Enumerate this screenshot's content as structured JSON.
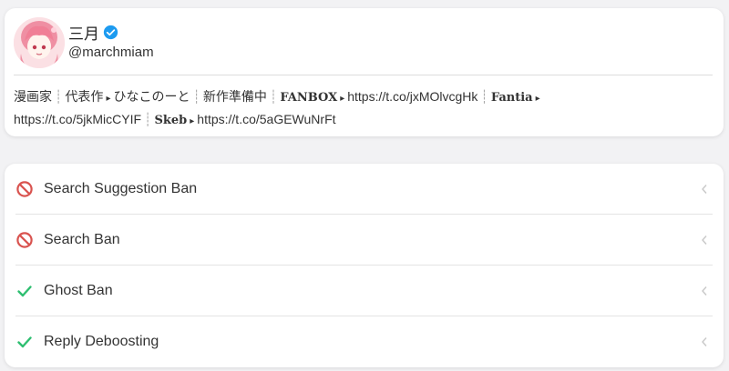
{
  "profile": {
    "display_name": "三月",
    "handle": "@marchmiam",
    "bio": {
      "p1": "漫画家",
      "p2": "代表作",
      "p3": "ひなこのーと",
      "p4": "新作準備中",
      "brand1": "FANBOX",
      "link1": "https://t.co/jxMOlvcgHk",
      "brand2": "Fantia",
      "link2": "https://t.co/5jkMicCYIF",
      "brand3": "Skeb",
      "link3": "https://t.co/5aGEWuNrFt"
    }
  },
  "checks": [
    {
      "label": "Search Suggestion Ban",
      "status": "banned",
      "icon": "no-entry-icon"
    },
    {
      "label": "Search Ban",
      "status": "banned",
      "icon": "no-entry-icon"
    },
    {
      "label": "Ghost Ban",
      "status": "ok",
      "icon": "checkmark-icon"
    },
    {
      "label": "Reply Deboosting",
      "status": "ok",
      "icon": "checkmark-icon"
    }
  ],
  "colors": {
    "banned": "#d9534f",
    "ok": "#2fbf71",
    "verified": "#1d9bf0",
    "chevron": "#c8c8c8"
  }
}
